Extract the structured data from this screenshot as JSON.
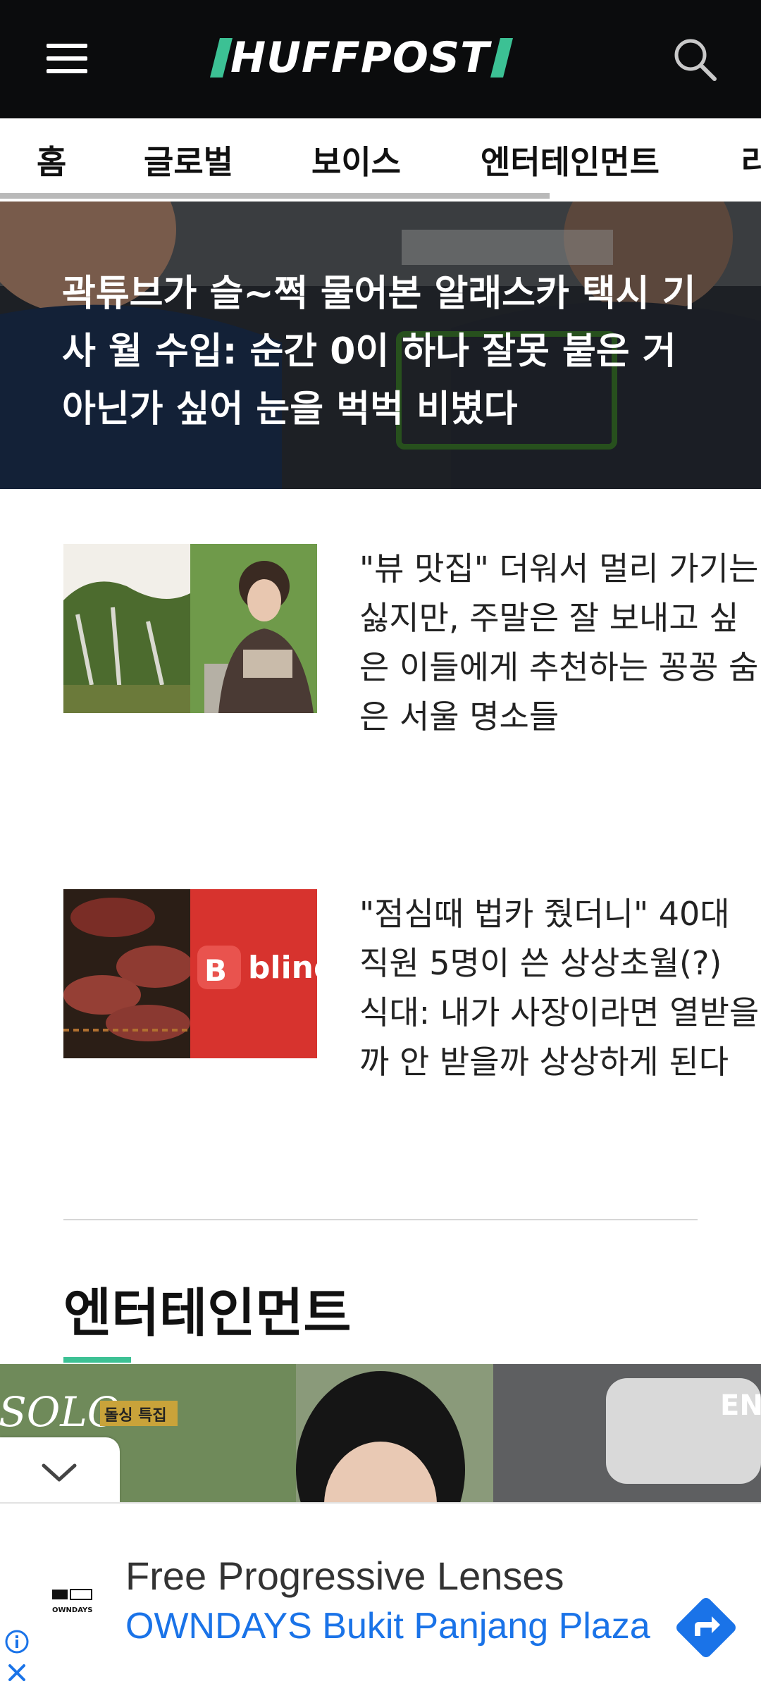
{
  "header": {
    "logo_text": "HUFFPOST",
    "menu_icon": "hamburger-menu-icon",
    "search_icon": "search-icon",
    "colors": {
      "background": "#0b0c0d",
      "accent": "#3cc194"
    }
  },
  "tabs": [
    {
      "label": "홈"
    },
    {
      "label": "글로벌"
    },
    {
      "label": "보이스"
    },
    {
      "label": "엔터테인먼트"
    },
    {
      "label": "라"
    }
  ],
  "hero": {
    "title": "곽튜브가 슬~쩍 물어본 알래스카 택시 기사 월 수입: 순간 0이 하나 잘못 붙은 거 아닌가 싶어 눈을 벅벅 비볐다"
  },
  "articles": [
    {
      "title": "\"뷰 맛집\" 더워서 멀리 가기는 싫지만, 주말은 잘 보내고 싶은 이들에게 추천하는 꽁꽁 숨은 서울 명소들"
    },
    {
      "title": "\"점심때 법카 줬더니\" 40대 직원 5명이 쓴 상상초월(?) 식대: 내가 사장이라면 열받을까 안 받을까 상상하게 된다",
      "thumb_text": "blind"
    }
  ],
  "section": {
    "title": "엔터테인먼트",
    "feature_logo": "SOLO",
    "feature_badge": "돌싱 특집",
    "feature_corner": "EN"
  },
  "ad": {
    "brand": "OWNDAYS",
    "title": "Free Progressive Lenses",
    "subtitle": "OWNDAYS Bukit Panjang Plaza",
    "colors": {
      "link": "#1a73e8"
    }
  }
}
